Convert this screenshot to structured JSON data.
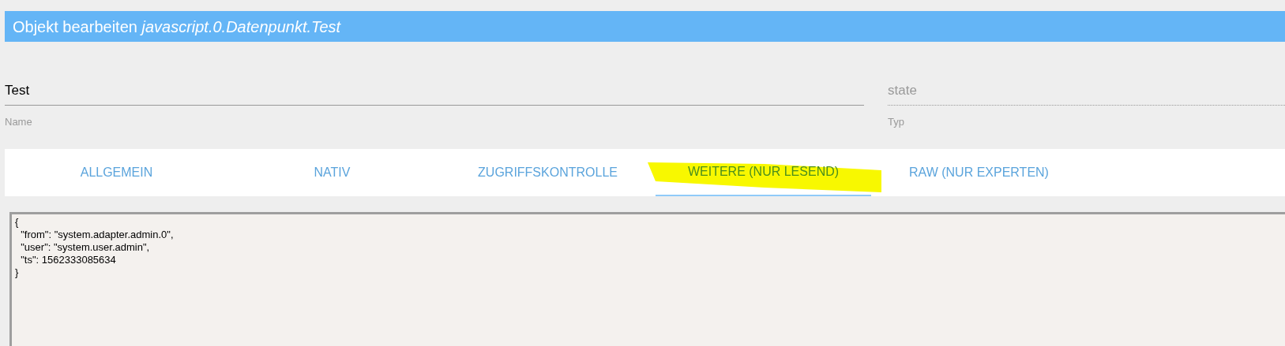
{
  "dialog": {
    "title": "Objekt bearbeiten",
    "object_id": "javascript.0.Datenpunkt.Test"
  },
  "fields": [
    {
      "label": "Name",
      "value": "Test",
      "kind": "text"
    },
    {
      "label": "Typ",
      "value": "state",
      "kind": "select"
    }
  ],
  "tabs": [
    {
      "label": "ALLGEMEIN",
      "selected": false
    },
    {
      "label": "NATIV",
      "selected": false
    },
    {
      "label": "ZUGRIFFSKONTROLLE",
      "selected": false
    },
    {
      "label": "WEITERE (NUR LESEND)",
      "selected": true
    },
    {
      "label": "RAW (NUR EXPERTEN)",
      "selected": false
    }
  ],
  "editor": {
    "content": "{\n  \"from\": \"system.adapter.admin.0\",\n  \"user\": \"system.user.admin\",\n  \"ts\": 1562333085634\n}"
  }
}
